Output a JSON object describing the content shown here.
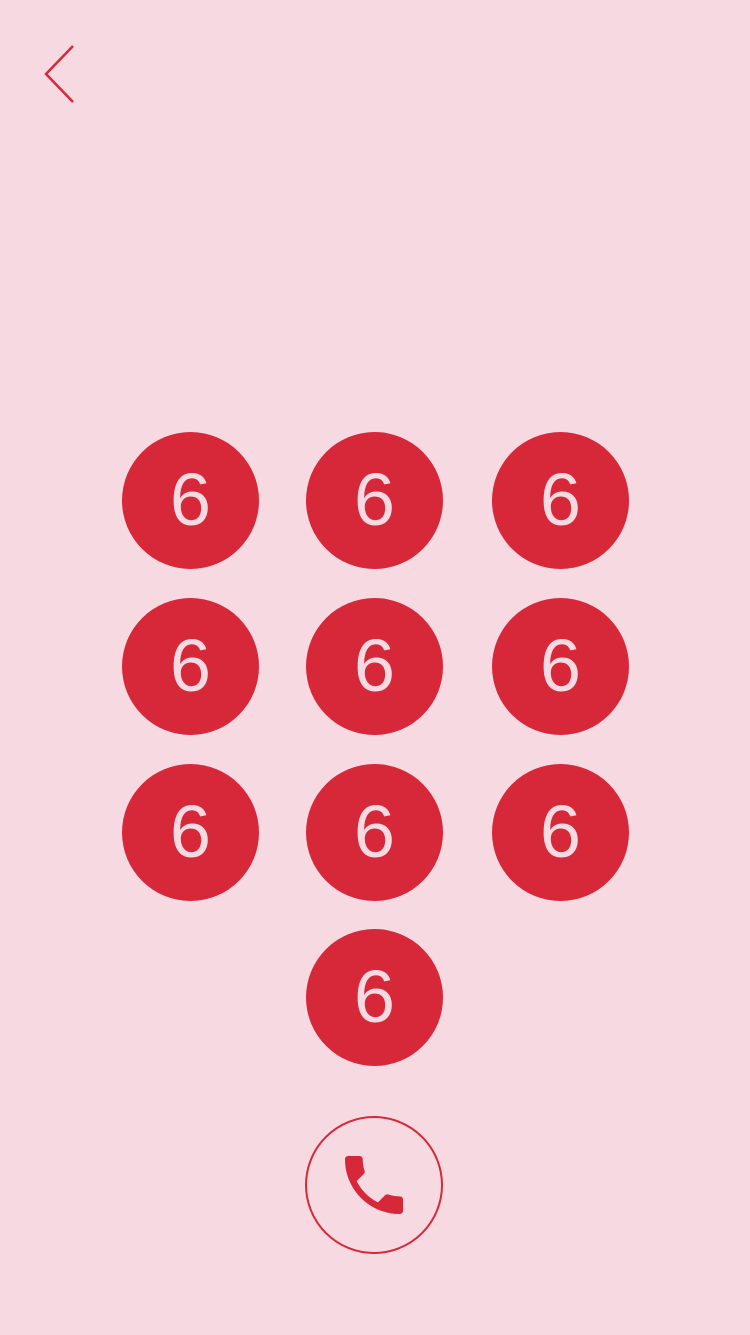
{
  "nav": {
    "back_icon": "chevron-left-icon"
  },
  "keypad": {
    "keys": [
      "6",
      "6",
      "6",
      "6",
      "6",
      "6",
      "6",
      "6",
      "6",
      "6"
    ]
  },
  "call": {
    "icon": "phone-icon"
  },
  "colors": {
    "background": "#f7d9e2",
    "accent": "#d7283a",
    "key_text": "#f7d9e2"
  }
}
